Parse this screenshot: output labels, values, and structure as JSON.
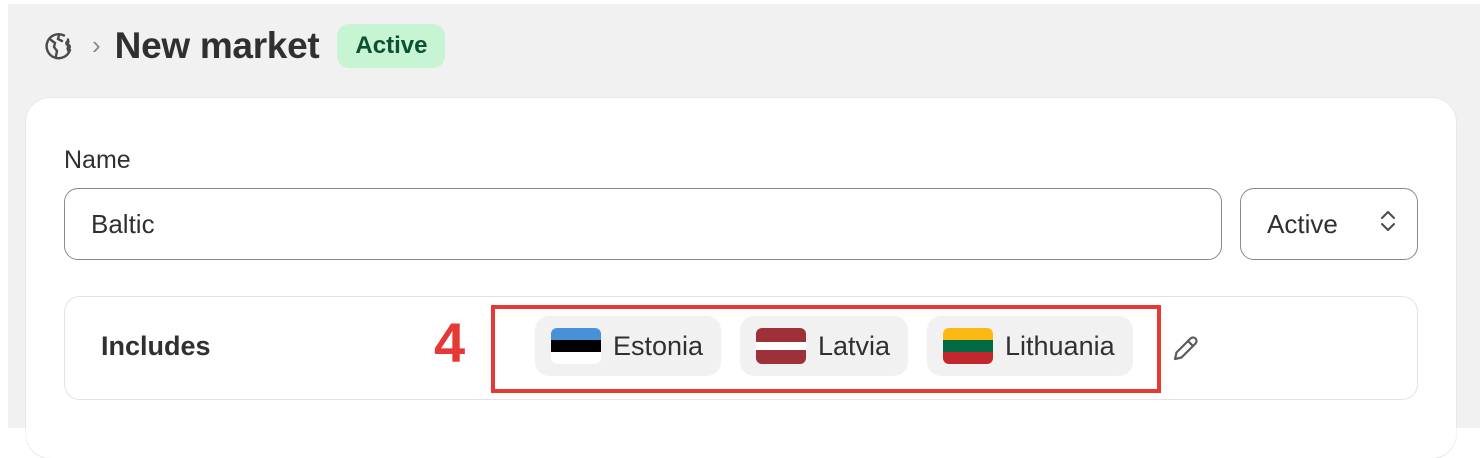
{
  "header": {
    "breadcrumb_icon": "markets-globe-icon",
    "separator": "›",
    "title": "New market",
    "status_badge": "Active"
  },
  "form": {
    "name_label": "Name",
    "name_value": "Baltic",
    "status_select_value": "Active",
    "includes_label": "Includes",
    "step_number": "4",
    "countries": [
      {
        "name": "Estonia",
        "flag_colors": [
          "#4891d9",
          "#000000",
          "#ffffff"
        ]
      },
      {
        "name": "Latvia",
        "flag_colors": [
          "#9e3039",
          "#ffffff",
          "#9e3039"
        ]
      },
      {
        "name": "Lithuania",
        "flag_colors": [
          "#fdb913",
          "#006a44",
          "#c1272d"
        ]
      }
    ]
  },
  "colors": {
    "badge_bg": "#c7f5d3",
    "badge_text": "#0c5132",
    "highlight": "#e53935"
  }
}
